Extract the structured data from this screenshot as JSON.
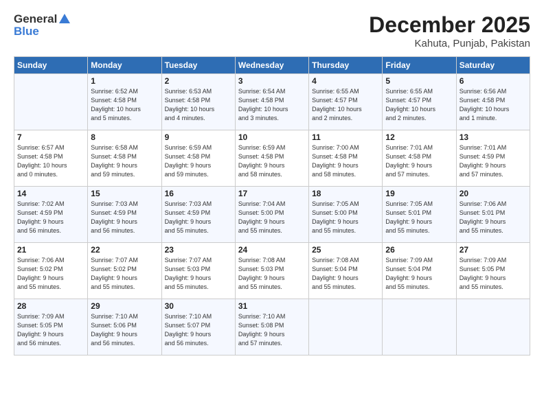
{
  "header": {
    "logo_general": "General",
    "logo_blue": "Blue",
    "month": "December 2025",
    "location": "Kahuta, Punjab, Pakistan"
  },
  "days_of_week": [
    "Sunday",
    "Monday",
    "Tuesday",
    "Wednesday",
    "Thursday",
    "Friday",
    "Saturday"
  ],
  "weeks": [
    [
      {
        "day": "",
        "info": ""
      },
      {
        "day": "1",
        "info": "Sunrise: 6:52 AM\nSunset: 4:58 PM\nDaylight: 10 hours\nand 5 minutes."
      },
      {
        "day": "2",
        "info": "Sunrise: 6:53 AM\nSunset: 4:58 PM\nDaylight: 10 hours\nand 4 minutes."
      },
      {
        "day": "3",
        "info": "Sunrise: 6:54 AM\nSunset: 4:58 PM\nDaylight: 10 hours\nand 3 minutes."
      },
      {
        "day": "4",
        "info": "Sunrise: 6:55 AM\nSunset: 4:57 PM\nDaylight: 10 hours\nand 2 minutes."
      },
      {
        "day": "5",
        "info": "Sunrise: 6:55 AM\nSunset: 4:57 PM\nDaylight: 10 hours\nand 2 minutes."
      },
      {
        "day": "6",
        "info": "Sunrise: 6:56 AM\nSunset: 4:58 PM\nDaylight: 10 hours\nand 1 minute."
      }
    ],
    [
      {
        "day": "7",
        "info": "Sunrise: 6:57 AM\nSunset: 4:58 PM\nDaylight: 10 hours\nand 0 minutes."
      },
      {
        "day": "8",
        "info": "Sunrise: 6:58 AM\nSunset: 4:58 PM\nDaylight: 9 hours\nand 59 minutes."
      },
      {
        "day": "9",
        "info": "Sunrise: 6:59 AM\nSunset: 4:58 PM\nDaylight: 9 hours\nand 59 minutes."
      },
      {
        "day": "10",
        "info": "Sunrise: 6:59 AM\nSunset: 4:58 PM\nDaylight: 9 hours\nand 58 minutes."
      },
      {
        "day": "11",
        "info": "Sunrise: 7:00 AM\nSunset: 4:58 PM\nDaylight: 9 hours\nand 58 minutes."
      },
      {
        "day": "12",
        "info": "Sunrise: 7:01 AM\nSunset: 4:58 PM\nDaylight: 9 hours\nand 57 minutes."
      },
      {
        "day": "13",
        "info": "Sunrise: 7:01 AM\nSunset: 4:59 PM\nDaylight: 9 hours\nand 57 minutes."
      }
    ],
    [
      {
        "day": "14",
        "info": "Sunrise: 7:02 AM\nSunset: 4:59 PM\nDaylight: 9 hours\nand 56 minutes."
      },
      {
        "day": "15",
        "info": "Sunrise: 7:03 AM\nSunset: 4:59 PM\nDaylight: 9 hours\nand 56 minutes."
      },
      {
        "day": "16",
        "info": "Sunrise: 7:03 AM\nSunset: 4:59 PM\nDaylight: 9 hours\nand 55 minutes."
      },
      {
        "day": "17",
        "info": "Sunrise: 7:04 AM\nSunset: 5:00 PM\nDaylight: 9 hours\nand 55 minutes."
      },
      {
        "day": "18",
        "info": "Sunrise: 7:05 AM\nSunset: 5:00 PM\nDaylight: 9 hours\nand 55 minutes."
      },
      {
        "day": "19",
        "info": "Sunrise: 7:05 AM\nSunset: 5:01 PM\nDaylight: 9 hours\nand 55 minutes."
      },
      {
        "day": "20",
        "info": "Sunrise: 7:06 AM\nSunset: 5:01 PM\nDaylight: 9 hours\nand 55 minutes."
      }
    ],
    [
      {
        "day": "21",
        "info": "Sunrise: 7:06 AM\nSunset: 5:02 PM\nDaylight: 9 hours\nand 55 minutes."
      },
      {
        "day": "22",
        "info": "Sunrise: 7:07 AM\nSunset: 5:02 PM\nDaylight: 9 hours\nand 55 minutes."
      },
      {
        "day": "23",
        "info": "Sunrise: 7:07 AM\nSunset: 5:03 PM\nDaylight: 9 hours\nand 55 minutes."
      },
      {
        "day": "24",
        "info": "Sunrise: 7:08 AM\nSunset: 5:03 PM\nDaylight: 9 hours\nand 55 minutes."
      },
      {
        "day": "25",
        "info": "Sunrise: 7:08 AM\nSunset: 5:04 PM\nDaylight: 9 hours\nand 55 minutes."
      },
      {
        "day": "26",
        "info": "Sunrise: 7:09 AM\nSunset: 5:04 PM\nDaylight: 9 hours\nand 55 minutes."
      },
      {
        "day": "27",
        "info": "Sunrise: 7:09 AM\nSunset: 5:05 PM\nDaylight: 9 hours\nand 55 minutes."
      }
    ],
    [
      {
        "day": "28",
        "info": "Sunrise: 7:09 AM\nSunset: 5:05 PM\nDaylight: 9 hours\nand 56 minutes."
      },
      {
        "day": "29",
        "info": "Sunrise: 7:10 AM\nSunset: 5:06 PM\nDaylight: 9 hours\nand 56 minutes."
      },
      {
        "day": "30",
        "info": "Sunrise: 7:10 AM\nSunset: 5:07 PM\nDaylight: 9 hours\nand 56 minutes."
      },
      {
        "day": "31",
        "info": "Sunrise: 7:10 AM\nSunset: 5:08 PM\nDaylight: 9 hours\nand 57 minutes."
      },
      {
        "day": "",
        "info": ""
      },
      {
        "day": "",
        "info": ""
      },
      {
        "day": "",
        "info": ""
      }
    ]
  ]
}
